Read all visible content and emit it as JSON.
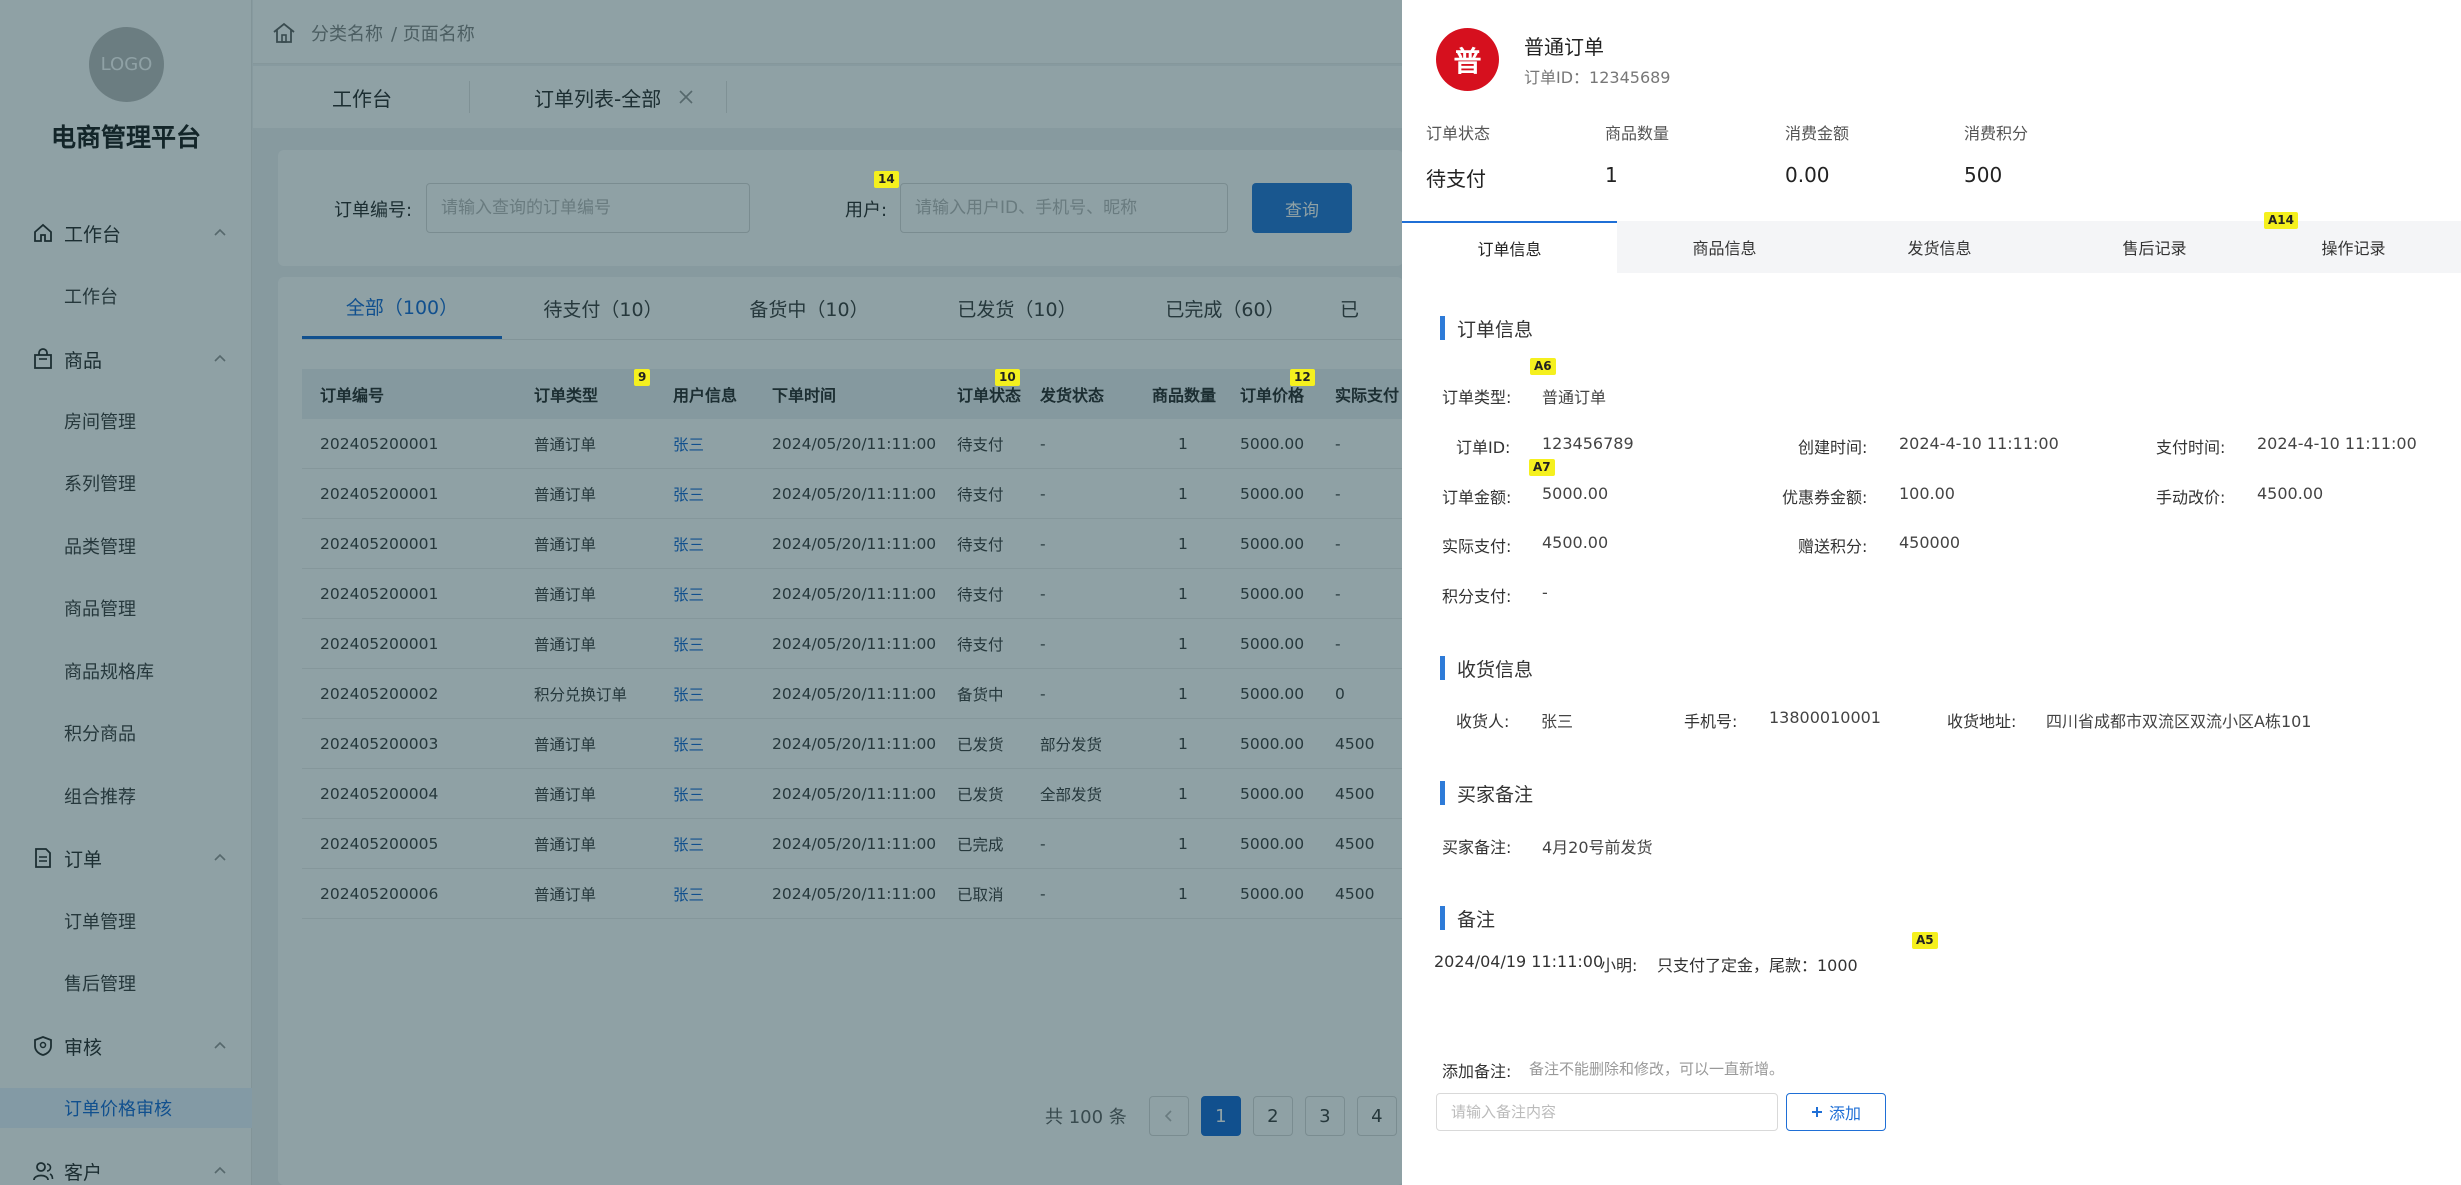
{
  "sidebar": {
    "logo": "LOGO",
    "brand": "电商管理平台",
    "groups": [
      {
        "label": "工作台",
        "icon": "home-icon",
        "items": [
          "工作台"
        ]
      },
      {
        "label": "商品",
        "icon": "bag-icon",
        "items": [
          "房间管理",
          "系列管理",
          "品类管理",
          "商品管理",
          "商品规格库",
          "积分商品",
          "组合推荐"
        ]
      },
      {
        "label": "订单",
        "icon": "document-icon",
        "items": [
          "订单管理",
          "售后管理"
        ]
      },
      {
        "label": "审核",
        "icon": "shield-icon",
        "items": [
          "订单价格审核"
        ]
      },
      {
        "label": "客户",
        "icon": "user-icon",
        "items": []
      }
    ]
  },
  "header": {
    "breadcrumb": [
      "分类名称",
      "/ 页面名称"
    ],
    "tabs": [
      "工作台",
      "订单列表-全部"
    ]
  },
  "search": {
    "order_label": "订单编号:",
    "order_placeholder": "请输入查询的订单编号",
    "user_label": "用户:",
    "user_placeholder": "请输入用户ID、手机号、昵称",
    "query_button": "查询"
  },
  "status_tabs": [
    "全部（100）",
    "待支付（10）",
    "备货中（10）",
    "已发货（10）",
    "已完成（60）",
    "已"
  ],
  "table": {
    "columns": [
      "订单编号",
      "订单类型",
      "用户信息",
      "下单时间",
      "订单状态",
      "发货状态",
      "商品数量",
      "订单价格",
      "实际支付"
    ],
    "rows": [
      [
        "202405200001",
        "普通订单",
        "张三",
        "2024/05/20/11:11:00",
        "待支付",
        "-",
        "1",
        "5000.00",
        "-"
      ],
      [
        "202405200001",
        "普通订单",
        "张三",
        "2024/05/20/11:11:00",
        "待支付",
        "-",
        "1",
        "5000.00",
        "-"
      ],
      [
        "202405200001",
        "普通订单",
        "张三",
        "2024/05/20/11:11:00",
        "待支付",
        "-",
        "1",
        "5000.00",
        "-"
      ],
      [
        "202405200001",
        "普通订单",
        "张三",
        "2024/05/20/11:11:00",
        "待支付",
        "-",
        "1",
        "5000.00",
        "-"
      ],
      [
        "202405200001",
        "普通订单",
        "张三",
        "2024/05/20/11:11:00",
        "待支付",
        "-",
        "1",
        "5000.00",
        "-"
      ],
      [
        "202405200002",
        "积分兑换订单",
        "张三",
        "2024/05/20/11:11:00",
        "备货中",
        "-",
        "1",
        "5000.00",
        "0"
      ],
      [
        "202405200003",
        "普通订单",
        "张三",
        "2024/05/20/11:11:00",
        "已发货",
        "部分发货",
        "1",
        "5000.00",
        "4500"
      ],
      [
        "202405200004",
        "普通订单",
        "张三",
        "2024/05/20/11:11:00",
        "已发货",
        "全部发货",
        "1",
        "5000.00",
        "4500"
      ],
      [
        "202405200005",
        "普通订单",
        "张三",
        "2024/05/20/11:11:00",
        "已完成",
        "-",
        "1",
        "5000.00",
        "4500"
      ],
      [
        "202405200006",
        "普通订单",
        "张三",
        "2024/05/20/11:11:00",
        "已取消",
        "-",
        "1",
        "5000.00",
        "4500"
      ]
    ]
  },
  "pagination": {
    "total": "共 100 条",
    "pages": [
      "1",
      "2",
      "3",
      "4"
    ]
  },
  "badges": {
    "b14": "14",
    "b9": "9",
    "b10": "10",
    "b12": "12",
    "a14": "A14",
    "a6": "A6",
    "a7": "A7",
    "a5": "A5"
  },
  "drawer": {
    "avatar": "普",
    "title": "普通订单",
    "order_id": "订单ID：12345689",
    "stats": [
      {
        "label": "订单状态",
        "value": "待支付"
      },
      {
        "label": "商品数量",
        "value": "1"
      },
      {
        "label": "消费金额",
        "value": "0.00"
      },
      {
        "label": "消费积分",
        "value": "500"
      }
    ],
    "tabs": [
      "订单信息",
      "商品信息",
      "发货信息",
      "售后记录",
      "操作记录"
    ],
    "order_info": {
      "title": "订单信息",
      "type_label": "订单类型:",
      "type_value": "普通订单",
      "id_label": "订单ID:",
      "id_value": "123456789",
      "created_label": "创建时间:",
      "created_value": "2024-4-10 11:11:00",
      "paid_label": "支付时间:",
      "paid_value": "2024-4-10 11:11:00",
      "amount_label": "订单金额:",
      "amount_value": "5000.00",
      "coupon_label": "优惠券金额:",
      "coupon_value": "100.00",
      "manual_label": "手动改价:",
      "manual_value": "4500.00",
      "actual_label": "实际支付:",
      "actual_value": "4500.00",
      "gift_label": "赠送积分:",
      "gift_value": "450000",
      "points_label": "积分支付:",
      "points_value": "-"
    },
    "shipping": {
      "title": "收货信息",
      "receiver_label": "收货人:",
      "receiver_value": "张三",
      "phone_label": "手机号:",
      "phone_value": "13800010001",
      "address_label": "收货地址:",
      "address_value": "四川省成都市双流区双流小区A栋101"
    },
    "buyer_note": {
      "title": "买家备注",
      "label": "买家备注:",
      "value": "4月20号前发货"
    },
    "remarks": {
      "title": "备注",
      "entry_time": "2024/04/19  11:11:00",
      "entry_author": "小明:",
      "entry_text": "只支付了定金，尾款：1000",
      "add_label": "添加备注:",
      "add_hint": "备注不能删除和修改，可以一直新增。",
      "input_placeholder": "请输入备注内容",
      "add_button": "添加"
    }
  }
}
